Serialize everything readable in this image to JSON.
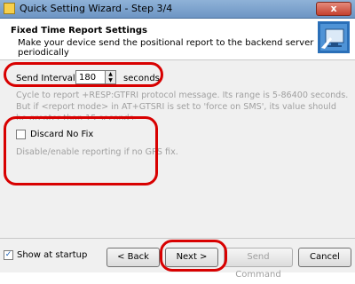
{
  "window": {
    "title": "Quick Setting Wizard - Step 3/4",
    "close_label": "x"
  },
  "header": {
    "title": "Fixed Time Report Settings",
    "subtitle": "Make your device send the positional report to the backend server periodically"
  },
  "interval": {
    "label": "Send Interval:",
    "value": "180",
    "unit": "seconds",
    "help": "Cycle to report +RESP:GTFRI protocol message. Its range is 5-86400 seconds. But if <report mode> in AT+GTSRI is set to 'force on SMS', its value should be greater than 15 seconds."
  },
  "discard": {
    "label": "Discard No Fix",
    "checked": false,
    "help": "Disable/enable reporting if no GPS fix."
  },
  "footer": {
    "show_at_startup_label": "Show at startup",
    "show_at_startup_checked": true,
    "buttons": {
      "back": "< Back",
      "next": "Next >",
      "send": "Send Command",
      "cancel": "Cancel"
    }
  },
  "colors": {
    "annotation": "#d80000",
    "titlebar": "#7aa0cc",
    "help_text": "#a0a0a0"
  }
}
